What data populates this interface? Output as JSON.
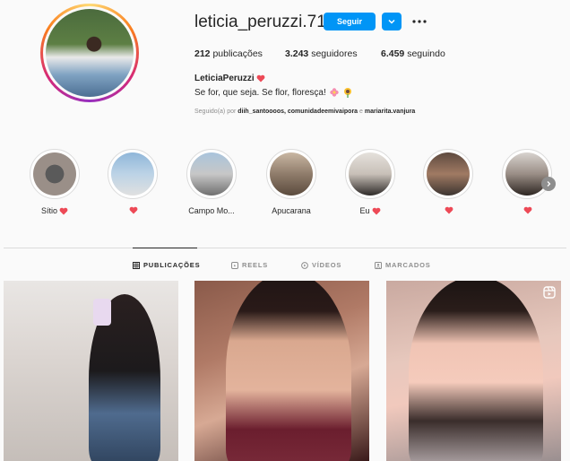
{
  "profile": {
    "username": "leticia_peruzzi.71",
    "follow_label": "Seguir",
    "posts_count": "212",
    "posts_label": "publicações",
    "followers_count": "3.243",
    "followers_label": "seguidores",
    "following_count": "6.459",
    "following_label": "seguindo",
    "full_name": "LeticiaPeruzzi",
    "bio": "Se for, que seja. Se flor, floresça!",
    "followed_by_prefix": "Seguido(a) por",
    "followed_by_names": "diih_santoooos, comunidadeemivaipora",
    "followed_by_and": "e",
    "followed_by_last": "mariarita.vanjura"
  },
  "highlights": [
    {
      "label": "Sítio",
      "heart": true
    },
    {
      "label": "",
      "heart": true
    },
    {
      "label": "Campo Mo...",
      "heart": false
    },
    {
      "label": "Apucarana",
      "heart": false
    },
    {
      "label": "Eu",
      "heart": true
    },
    {
      "label": "",
      "heart": true
    },
    {
      "label": "",
      "heart": true
    }
  ],
  "tabs": [
    {
      "label": "PUBLICAÇÕES",
      "icon": "grid-icon",
      "active": true
    },
    {
      "label": "REELS",
      "icon": "reels-icon",
      "active": false
    },
    {
      "label": "VÍDEOS",
      "icon": "video-icon",
      "active": false
    },
    {
      "label": "MARCADOS",
      "icon": "tagged-icon",
      "active": false
    }
  ],
  "colors": {
    "accent": "#0095f6",
    "heart": "#ed4956",
    "text": "#262626",
    "muted": "#8e8e8e"
  }
}
